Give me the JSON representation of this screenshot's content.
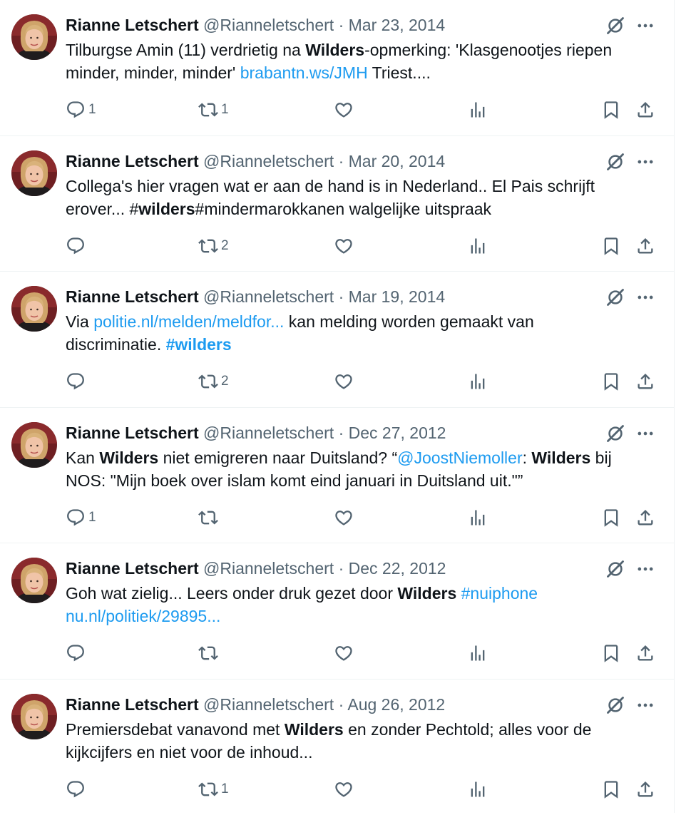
{
  "account": {
    "name": "Rianne Letschert",
    "handle": "@Rianneletschert",
    "separator": "·"
  },
  "icons": {
    "reply": "reply-icon",
    "retweet": "retweet-icon",
    "like": "heart-icon",
    "views": "views-icon",
    "bookmark": "bookmark-icon",
    "share": "share-icon",
    "grok": "grok-icon",
    "more": "more-icon"
  },
  "colors": {
    "text": "#0f1419",
    "secondary": "#536471",
    "link": "#1d9bf0",
    "divider": "#eff3f4"
  },
  "tweets": [
    {
      "date": "Mar 23, 2014",
      "text": {
        "line1": {
          "a": "Tilburgse Amin (11) verdrietig na ",
          "b": "Wilders",
          "c": "-opmerking: 'Klasgenootjes riepen"
        },
        "line2": {
          "a": "minder, minder, minder' ",
          "link": "brabantn.ws/JMH",
          "c": " Triest...."
        }
      },
      "replies": "1",
      "retweets": "1"
    },
    {
      "date": "Mar 20, 2014",
      "text": {
        "line1": "Collega's hier vragen wat er aan de hand is in Nederland.. El Pais schrijft",
        "line2": {
          "a": "erover... #",
          "b": "wilders",
          "c": "#mindermarokkanen walgelijke uitspraak"
        }
      },
      "replies": "",
      "retweets": "2"
    },
    {
      "date": "Mar 19, 2014",
      "text": {
        "line1": {
          "a": "Via ",
          "link": "politie.nl/melden/meldfor...",
          "c": " kan melding worden gemaakt van"
        },
        "line2": {
          "a": "discriminatie. ",
          "hashtag": "#wilders"
        }
      },
      "replies": "",
      "retweets": "2"
    },
    {
      "date": "Dec 27, 2012",
      "text": {
        "line1": {
          "a": "Kan ",
          "b": "Wilders",
          "c": " niet emigreren naar Duitsland? “",
          "mention": "@JoostNiemoller",
          "d": ": ",
          "e": "Wilders",
          "f": " bij"
        },
        "line2": "NOS: \"Mijn boek over islam komt eind januari in Duitsland uit.\"”"
      },
      "replies": "1",
      "retweets": ""
    },
    {
      "date": "Dec 22, 2012",
      "text": {
        "line1": {
          "a": "Goh wat zielig... Leers onder druk gezet door ",
          "b": "Wilders",
          "c": " ",
          "hashtag": "#nuiphone"
        },
        "line2": {
          "link": "nu.nl/politiek/29895..."
        }
      },
      "replies": "",
      "retweets": ""
    },
    {
      "date": "Aug 26, 2012",
      "text": {
        "line1": {
          "a": "Premiersdebat vanavond met ",
          "b": "Wilders",
          "c": " en zonder Pechtold; alles voor de"
        },
        "line2": "kijkcijfers en niet voor de inhoud..."
      },
      "replies": "",
      "retweets": "1"
    }
  ]
}
